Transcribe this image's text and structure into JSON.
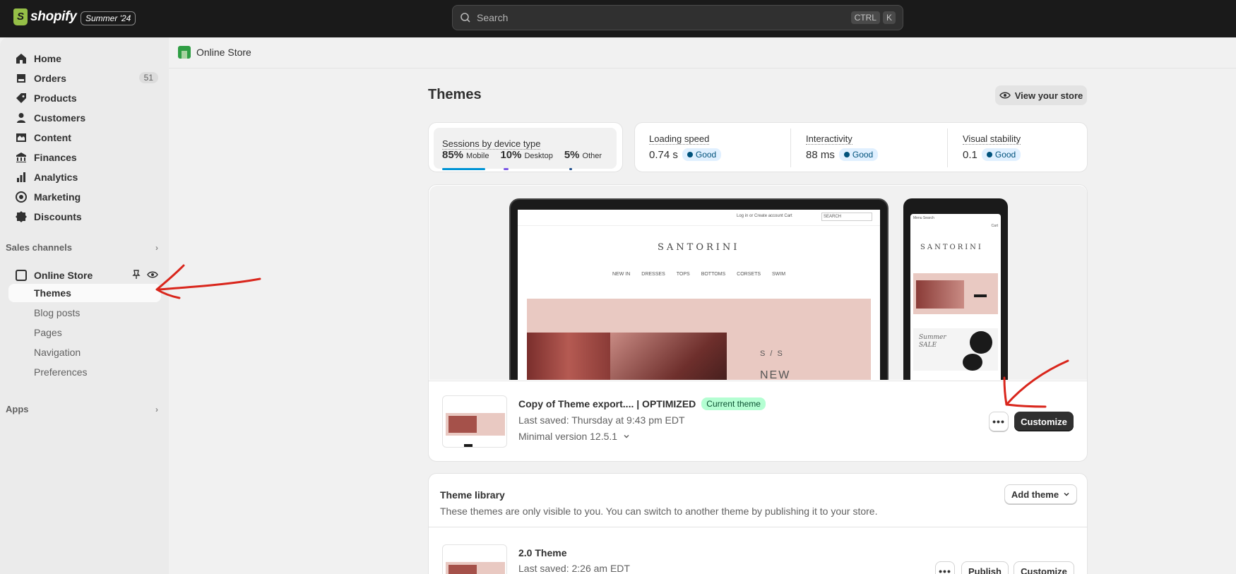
{
  "topbar": {
    "brand": "shopify",
    "edition": "Summer '24",
    "search_placeholder": "Search",
    "shortcut_ctrl": "CTRL",
    "shortcut_k": "K"
  },
  "sidebar": {
    "items": [
      {
        "label": "Home",
        "icon": "home-icon"
      },
      {
        "label": "Orders",
        "icon": "orders-icon",
        "badge": "51"
      },
      {
        "label": "Products",
        "icon": "tag-icon"
      },
      {
        "label": "Customers",
        "icon": "person-icon"
      },
      {
        "label": "Content",
        "icon": "content-icon"
      },
      {
        "label": "Finances",
        "icon": "bank-icon"
      },
      {
        "label": "Analytics",
        "icon": "chart-icon"
      },
      {
        "label": "Marketing",
        "icon": "target-icon"
      },
      {
        "label": "Discounts",
        "icon": "discount-icon"
      }
    ],
    "sales_channels_label": "Sales channels",
    "online_store_label": "Online Store",
    "sub_items": [
      "Themes",
      "Blog posts",
      "Pages",
      "Navigation",
      "Preferences"
    ],
    "apps_label": "Apps"
  },
  "breadcrumb": {
    "label": "Online Store"
  },
  "page": {
    "title": "Themes",
    "view_store": "View your store"
  },
  "sessions": {
    "label": "Sessions by device type",
    "devices": [
      {
        "pct": "85%",
        "name": "Mobile",
        "fraction": 0.85,
        "color": "#0094d5"
      },
      {
        "pct": "10%",
        "name": "Desktop",
        "fraction": 0.1,
        "color": "#7c59e6"
      },
      {
        "pct": "5%",
        "name": "Other",
        "fraction": 0.05,
        "color": "#1f4e8c"
      }
    ]
  },
  "metrics": [
    {
      "label": "Loading speed",
      "value": "0.74 s",
      "status": "Good"
    },
    {
      "label": "Interactivity",
      "value": "88 ms",
      "status": "Good"
    },
    {
      "label": "Visual stability",
      "value": "0.1",
      "status": "Good"
    }
  ],
  "preview": {
    "brand": "SANTORINI",
    "top_links": "Log in  or  Create account      Cart",
    "search_text": "SEARCH",
    "nav": [
      "NEW IN",
      "DRESSES",
      "TOPS",
      "BOTTOMS",
      "CORSETS",
      "SWIM"
    ],
    "banner_text": "S / S",
    "banner_text2": "NEW",
    "phone_menu": "Menu   Search",
    "phone_cart": "Cart",
    "phone_sale": "Summer SALE"
  },
  "current_theme": {
    "name": "Copy of Theme export.... | OPTIMIZED",
    "badge": "Current theme",
    "last_saved": "Last saved: Thursday at 9:43 pm EDT",
    "version": "Minimal version 12.5.1",
    "more_label": "•••",
    "customize_label": "Customize"
  },
  "library": {
    "title": "Theme library",
    "description": "These themes are only visible to you. You can switch to another theme by publishing it to your store.",
    "add_theme": "Add theme",
    "themes": [
      {
        "name": "2.0 Theme",
        "last_saved": "Last saved: 2:26 am EDT",
        "more_label": "•••",
        "publish_label": "Publish",
        "customize_label": "Customize"
      }
    ]
  },
  "colors": {
    "annotation": "#d9261c",
    "good_badge": "#e0f0ff",
    "current_badge": "#b4fed2"
  }
}
